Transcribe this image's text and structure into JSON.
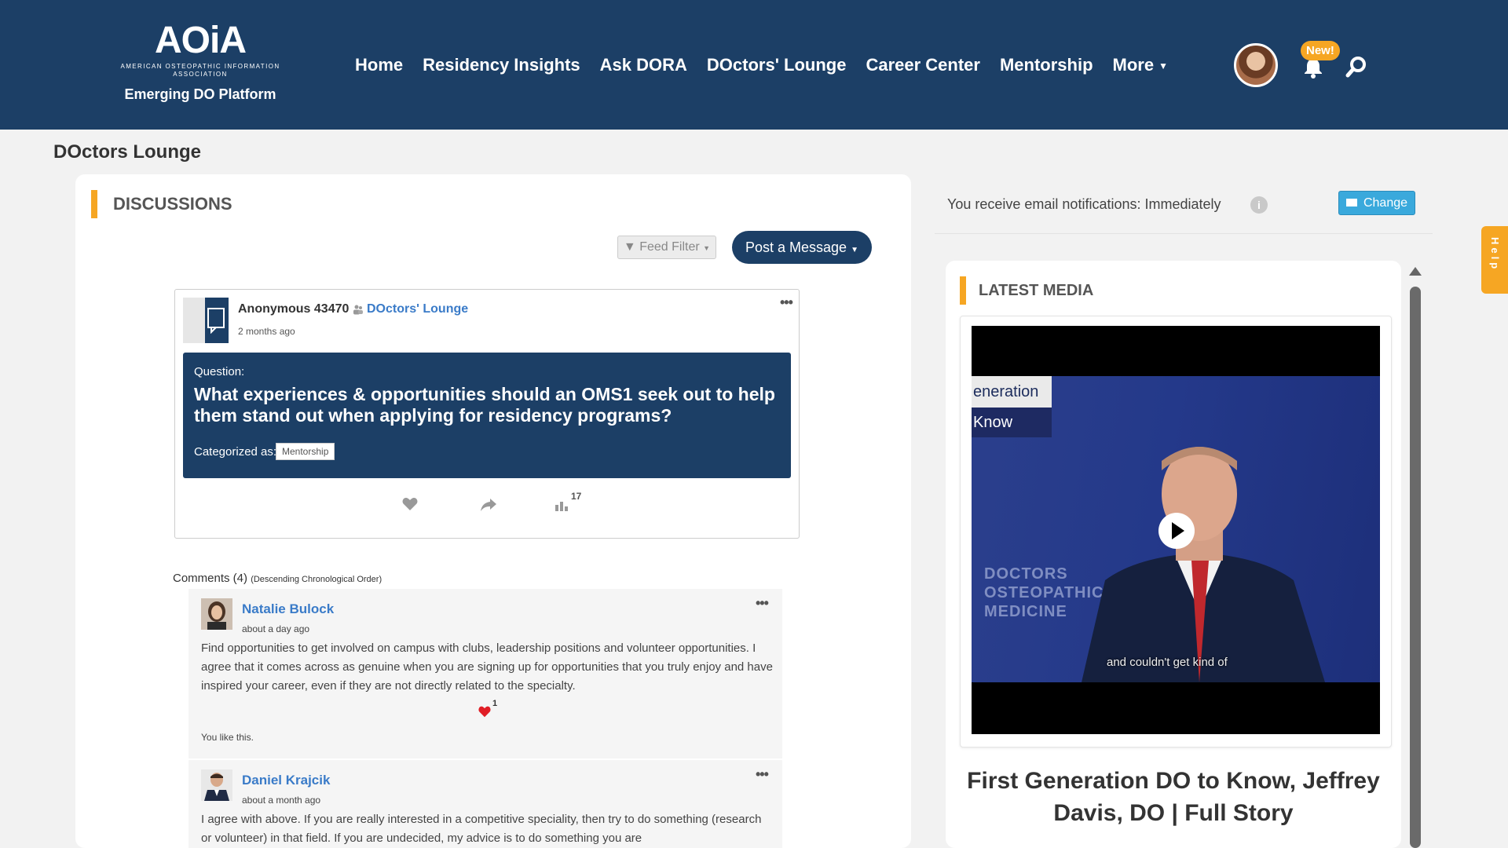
{
  "header": {
    "logo_text": "AOiA",
    "logo_subtext": "AMERICAN OSTEOPATHIC INFORMATION ASSOCIATION",
    "platform_name": "Emerging DO Platform",
    "nav": [
      {
        "label": "Home"
      },
      {
        "label": "Residency Insights"
      },
      {
        "label": "Ask DORA"
      },
      {
        "label": "DOctors' Lounge"
      },
      {
        "label": "Career Center"
      },
      {
        "label": "Mentorship"
      },
      {
        "label": "More"
      }
    ],
    "new_badge": "New!"
  },
  "page_title": "DOctors Lounge",
  "discussions": {
    "heading": "DISCUSSIONS",
    "feed_filter_label": "Feed Filter",
    "post_message_label": "Post a Message",
    "post": {
      "author": "Anonymous 43470",
      "group": "DOctors' Lounge",
      "time": "2 months ago",
      "question_label": "Question:",
      "question_text": "What experiences & opportunities should an OMS1 seek out to help them stand out when applying for residency programs?",
      "categorized_label": "Categorized as:",
      "category": "Mentorship",
      "views": "17"
    },
    "comments_label": "Comments (4)",
    "comments_order": "(Descending Chronological Order)",
    "comments": [
      {
        "name": "Natalie Bulock",
        "time": "about a day ago",
        "text": "Find opportunities to get involved on campus with clubs, leadership positions and volunteer opportunities. I agree that it comes across as genuine when you are signing up for opportunities that you truly enjoy and have inspired your career, even if they are not directly related to the specialty.",
        "likes": "1",
        "you_like": "You like this."
      },
      {
        "name": "Daniel Krajcik",
        "time": "about a month ago",
        "text": "I agree with above. If you are really interested in a competitive speciality, then try to do something (research or volunteer) in that field. If you are undecided, my advice is to do something you are"
      }
    ]
  },
  "notifications": {
    "text": "You receive email notifications: Immediately",
    "change_label": "Change"
  },
  "latest_media": {
    "heading": "LATEST MEDIA",
    "video_overlay_1": "eneration",
    "video_overlay_2": "Know",
    "video_bg_text": "DOCTORS OSTEOPATHIC MEDICINE",
    "subtitle": "and couldn't get kind of",
    "title": "First Generation DO to Know, Jeffrey Davis, DO | Full Story"
  },
  "help_label": "Help",
  "colors": {
    "header": "#1c3f66",
    "accent": "#f6a623",
    "link": "#3a7bc8"
  }
}
